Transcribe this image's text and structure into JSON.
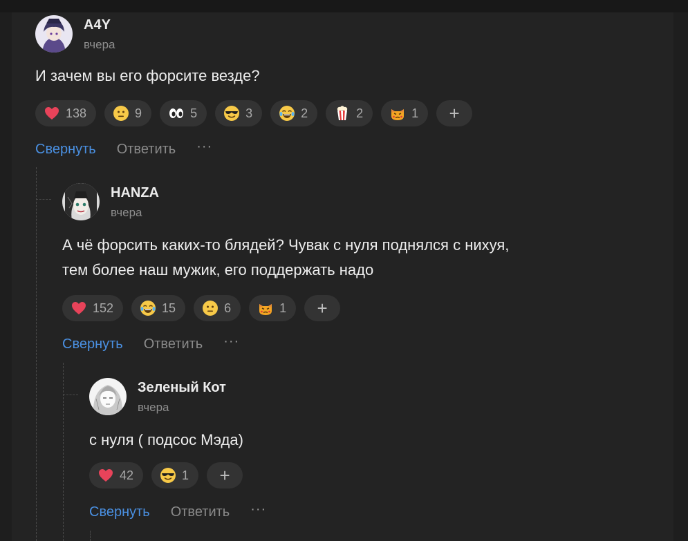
{
  "comments": [
    {
      "author": "A4Y",
      "time": "вчера",
      "text": "И зачем вы его форсите везде?",
      "reactions": [
        {
          "icon": "heart",
          "count": "138"
        },
        {
          "icon": "neutral-face",
          "count": "9"
        },
        {
          "icon": "eyes",
          "count": "5"
        },
        {
          "icon": "sunglasses-face",
          "count": "3"
        },
        {
          "icon": "joy-face",
          "count": "2"
        },
        {
          "icon": "popcorn",
          "count": "2"
        },
        {
          "icon": "pouting-cat",
          "count": "1"
        }
      ],
      "add_label": "+",
      "collapse": "Свернуть",
      "reply": "Ответить",
      "more": "···"
    },
    {
      "author": "HANZA",
      "time": "вчера",
      "text_line1": "А чё форсить каких-то блядей? Чувак с нуля поднялся с нихуя,",
      "text_line2": "тем более наш мужик, его поддержать надо",
      "reactions": [
        {
          "icon": "heart",
          "count": "152"
        },
        {
          "icon": "joy-face",
          "count": "15"
        },
        {
          "icon": "neutral-face",
          "count": "6"
        },
        {
          "icon": "pouting-cat",
          "count": "1"
        }
      ],
      "add_label": "+",
      "collapse": "Свернуть",
      "reply": "Ответить",
      "more": "···"
    },
    {
      "author": "Зеленый Кот",
      "time": "вчера",
      "text": "с нуля ( подсос Мэда)",
      "reactions": [
        {
          "icon": "heart",
          "count": "42"
        },
        {
          "icon": "sunglasses-face",
          "count": "1"
        }
      ],
      "add_label": "+",
      "collapse": "Свернуть",
      "reply": "Ответить",
      "more": "···"
    }
  ],
  "colors": {
    "background": "#1e1e1e",
    "panel": "#232323",
    "chip": "#333333",
    "link": "#4a90e2",
    "muted": "#8e8e8e",
    "heart": "#e8435a",
    "emoji_yellow": "#f7c948"
  }
}
